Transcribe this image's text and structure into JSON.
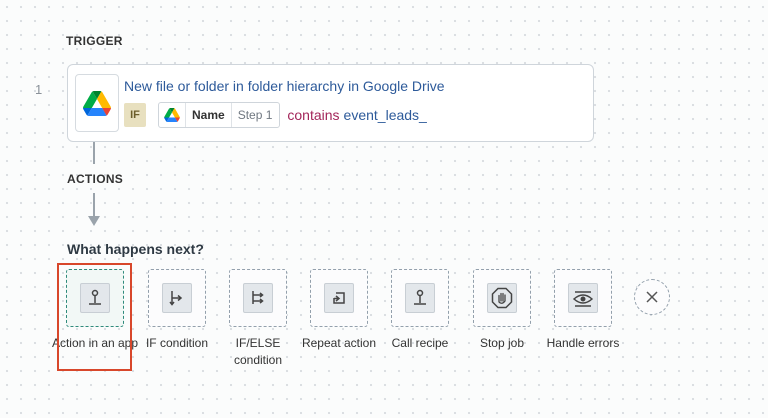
{
  "trigger": {
    "section_label": "TRIGGER",
    "step_number": "1",
    "app_icon": "google-drive-icon",
    "title": "New file or folder in folder hierarchy in Google Drive",
    "condition": {
      "badge": "IF",
      "pill": {
        "icon": "google-drive-icon",
        "name": "Name",
        "step": "Step 1"
      },
      "operator": "contains",
      "value": "event_leads_"
    }
  },
  "actions": {
    "section_label": "ACTIONS",
    "question": "What happens next?",
    "options": [
      {
        "label": "Action in an app",
        "icon": "app-action-icon",
        "selected": true
      },
      {
        "label": "IF condition",
        "icon": "if-condition-icon"
      },
      {
        "label": "IF/ELSE condition",
        "icon": "if-else-condition-icon"
      },
      {
        "label": "Repeat action",
        "icon": "repeat-icon"
      },
      {
        "label": "Call recipe",
        "icon": "call-recipe-icon"
      },
      {
        "label": "Stop job",
        "icon": "stop-hand-icon"
      },
      {
        "label": "Handle errors",
        "icon": "eye-icon"
      }
    ],
    "close_icon": "close-icon"
  },
  "colors": {
    "highlight": "#d8472b",
    "selected_tile": "#2f8a7b",
    "link_blue": "#2d5a9a",
    "operator": "#a3265a"
  }
}
